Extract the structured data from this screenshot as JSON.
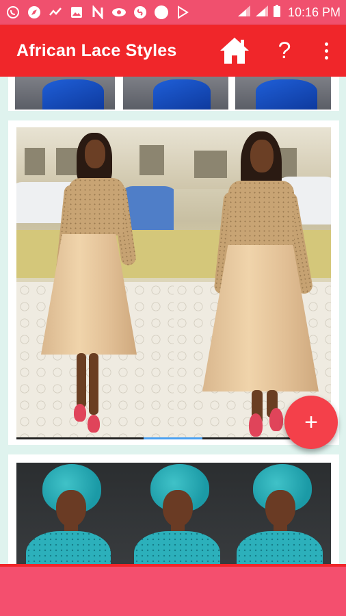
{
  "status_bar": {
    "time": "10:16 PM",
    "icons": [
      "whatsapp-icon",
      "compass-icon",
      "chart-icon",
      "image-icon",
      "n-icon",
      "eye-icon",
      "shazam-icon",
      "circle-icon",
      "play-icon"
    ],
    "right_icons": [
      "signal-icon",
      "signal-icon",
      "battery-icon"
    ]
  },
  "app_bar": {
    "title": "African Lace Styles",
    "help_label": "?",
    "color": "#f0262a"
  },
  "fab": {
    "label": "+"
  },
  "colors": {
    "status_bar": "#f0506e",
    "app_bar": "#f0262a",
    "content_bg": "#dff3ee",
    "fab": "#f4404a",
    "bottom_bar": "#f44f6e"
  }
}
